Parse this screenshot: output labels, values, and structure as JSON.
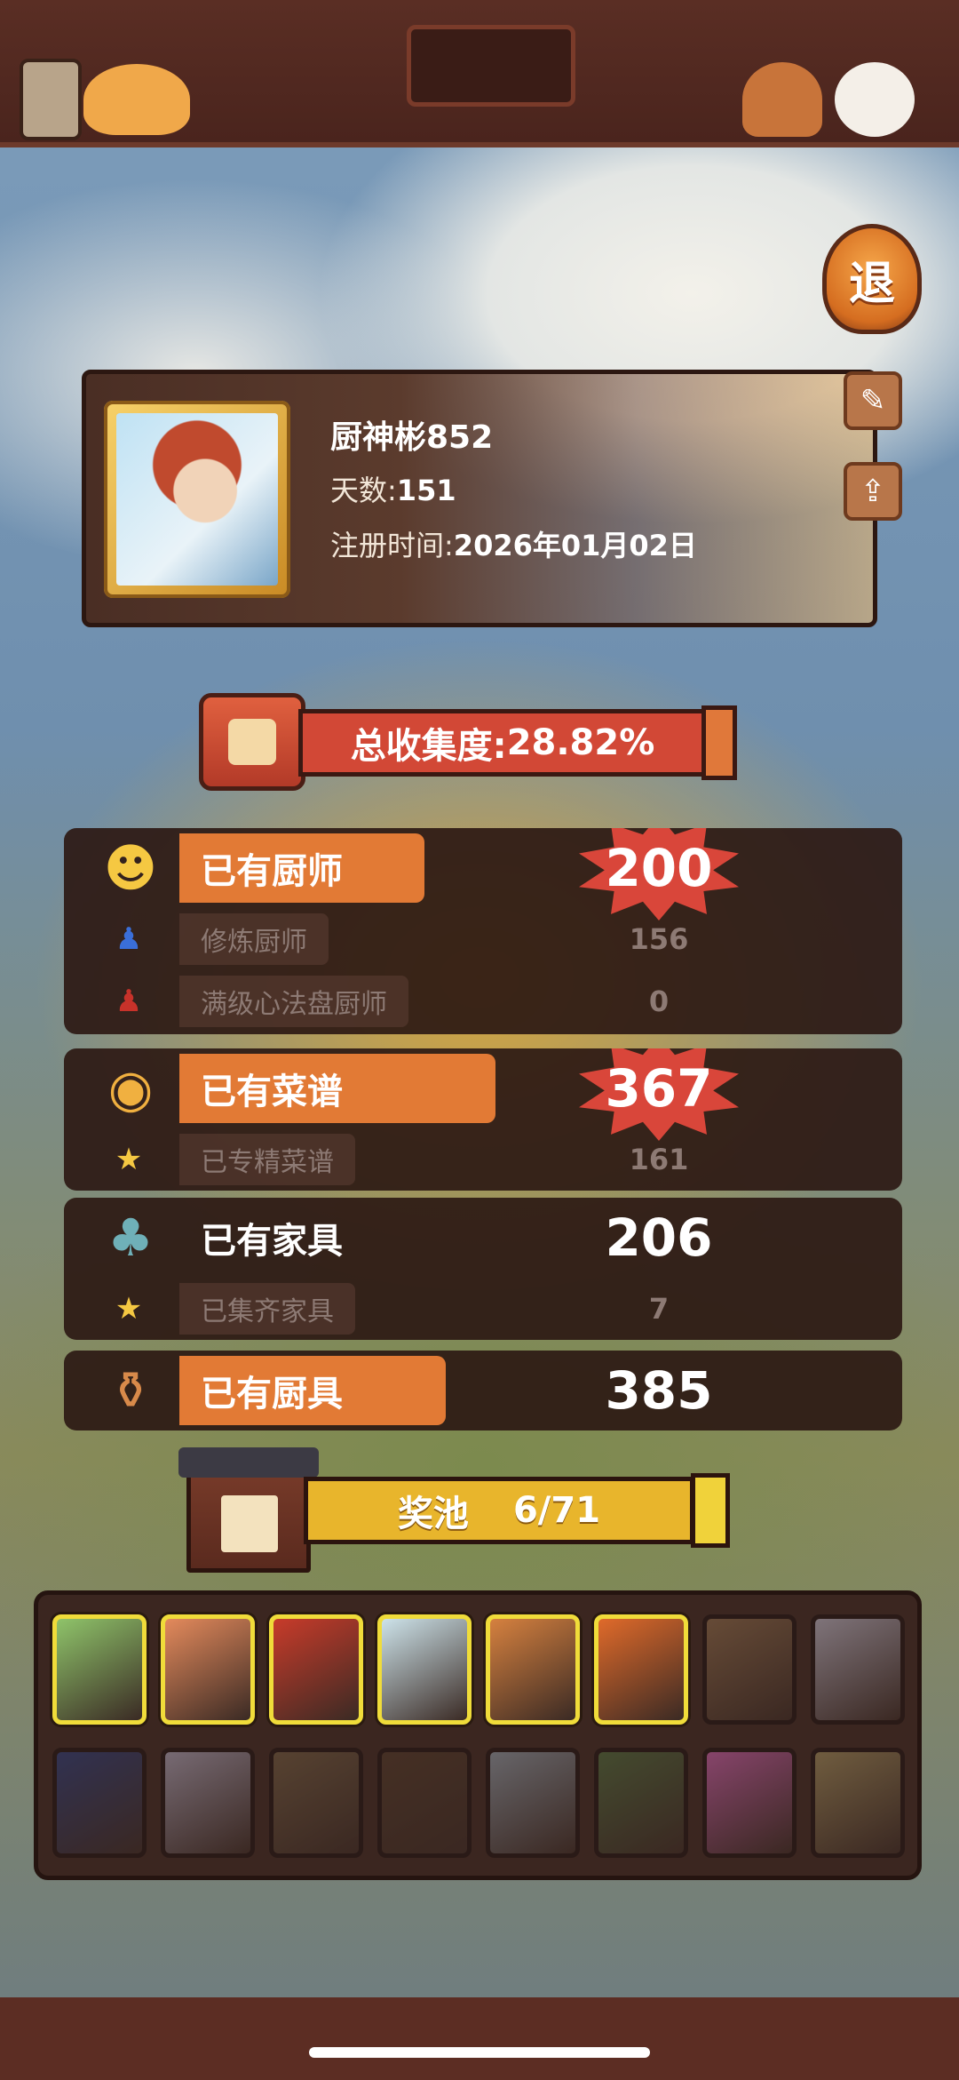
{
  "topbar": {
    "title": ""
  },
  "exit_button": {
    "label": "退"
  },
  "profile": {
    "name": "厨神彬852",
    "days_label": "天数:",
    "days_value": "151",
    "reg_label": "注册时间:",
    "reg_value": "2026年01月02日"
  },
  "collection": {
    "label": "总收集度:",
    "value": "28.82%"
  },
  "stats": {
    "chefs": {
      "label": "已有厨师",
      "value": "200",
      "sub": [
        {
          "label": "修炼厨师",
          "value": "156"
        },
        {
          "label": "满级心法盘厨师",
          "value": "0"
        }
      ]
    },
    "recipes": {
      "label": "已有菜谱",
      "value": "367",
      "sub": [
        {
          "label": "已专精菜谱",
          "value": "161"
        }
      ]
    },
    "furniture": {
      "label": "已有家具",
      "value": "206",
      "sub": [
        {
          "label": "已集齐家具",
          "value": "7"
        }
      ]
    },
    "tools": {
      "label": "已有厨具",
      "value": "385"
    }
  },
  "prize_pool": {
    "label": "奖池",
    "value": "6/71"
  },
  "pool_cards": [
    {
      "owned": true,
      "color": "#8fc46a"
    },
    {
      "owned": true,
      "color": "#e48a5c"
    },
    {
      "owned": true,
      "color": "#c83b2a"
    },
    {
      "owned": true,
      "color": "#cde3ea"
    },
    {
      "owned": true,
      "color": "#d6813f"
    },
    {
      "owned": true,
      "color": "#e06a2a"
    },
    {
      "owned": false,
      "color": "#8a6a4a"
    },
    {
      "owned": false,
      "color": "#b7b4c4"
    },
    {
      "owned": false,
      "color": "#2a3c7a"
    },
    {
      "owned": false,
      "color": "#a9a3b8"
    },
    {
      "owned": false,
      "color": "#6e5a40"
    },
    {
      "owned": false,
      "color": "#4e3828"
    },
    {
      "owned": false,
      "color": "#8c9aa6"
    },
    {
      "owned": false,
      "color": "#4c6a3c"
    },
    {
      "owned": false,
      "color": "#c55ea8"
    },
    {
      "owned": false,
      "color": "#9c8a5a"
    }
  ]
}
